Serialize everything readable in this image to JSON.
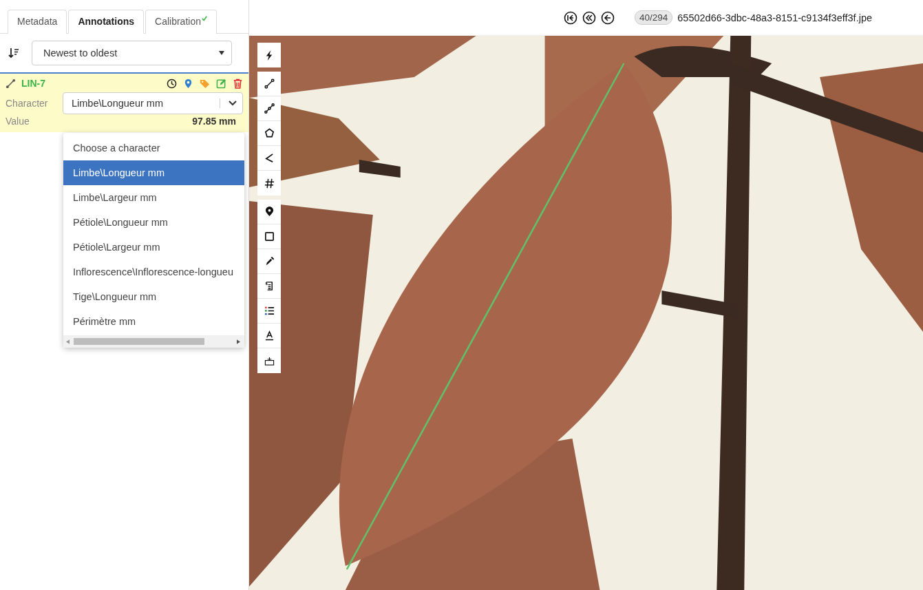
{
  "tabs": [
    {
      "label": "Metadata",
      "selected": false,
      "checked": false
    },
    {
      "label": "Annotations",
      "selected": true,
      "checked": false
    },
    {
      "label": "Calibration",
      "selected": false,
      "checked": true
    }
  ],
  "sort": {
    "value": "Newest to oldest"
  },
  "annotation": {
    "id": "LIN-7",
    "character_label": "Character",
    "character_value": "Limbe\\Longueur mm",
    "value_label": "Value",
    "value": "97.85 mm"
  },
  "dropdown": {
    "options": [
      {
        "label": "Choose a character",
        "selected": false
      },
      {
        "label": "Limbe\\Longueur mm",
        "selected": true
      },
      {
        "label": "Limbe\\Largeur mm",
        "selected": false
      },
      {
        "label": "Pétiole\\Longueur mm",
        "selected": false
      },
      {
        "label": "Pétiole\\Largeur mm",
        "selected": false
      },
      {
        "label": "Inflorescence\\Inflorescence-longueu",
        "selected": false
      },
      {
        "label": "Tige\\Longueur mm",
        "selected": false
      },
      {
        "label": "Périmètre mm",
        "selected": false
      }
    ]
  },
  "navigation": {
    "counter": "40/294",
    "filename": "65502d66-3dbc-48a3-8151-c9134f3eff3f.jpe"
  },
  "toolbar": [
    [
      {
        "kind": "bolt"
      }
    ],
    [
      {
        "kind": "line"
      },
      {
        "kind": "polyline"
      },
      {
        "kind": "polygon"
      },
      {
        "kind": "angle"
      },
      {
        "kind": "count"
      }
    ],
    [
      {
        "kind": "point"
      },
      {
        "kind": "rect"
      },
      {
        "kind": "color"
      },
      {
        "kind": "transcribe"
      },
      {
        "kind": "categories"
      },
      {
        "kind": "text"
      },
      {
        "kind": "scale"
      }
    ]
  ]
}
